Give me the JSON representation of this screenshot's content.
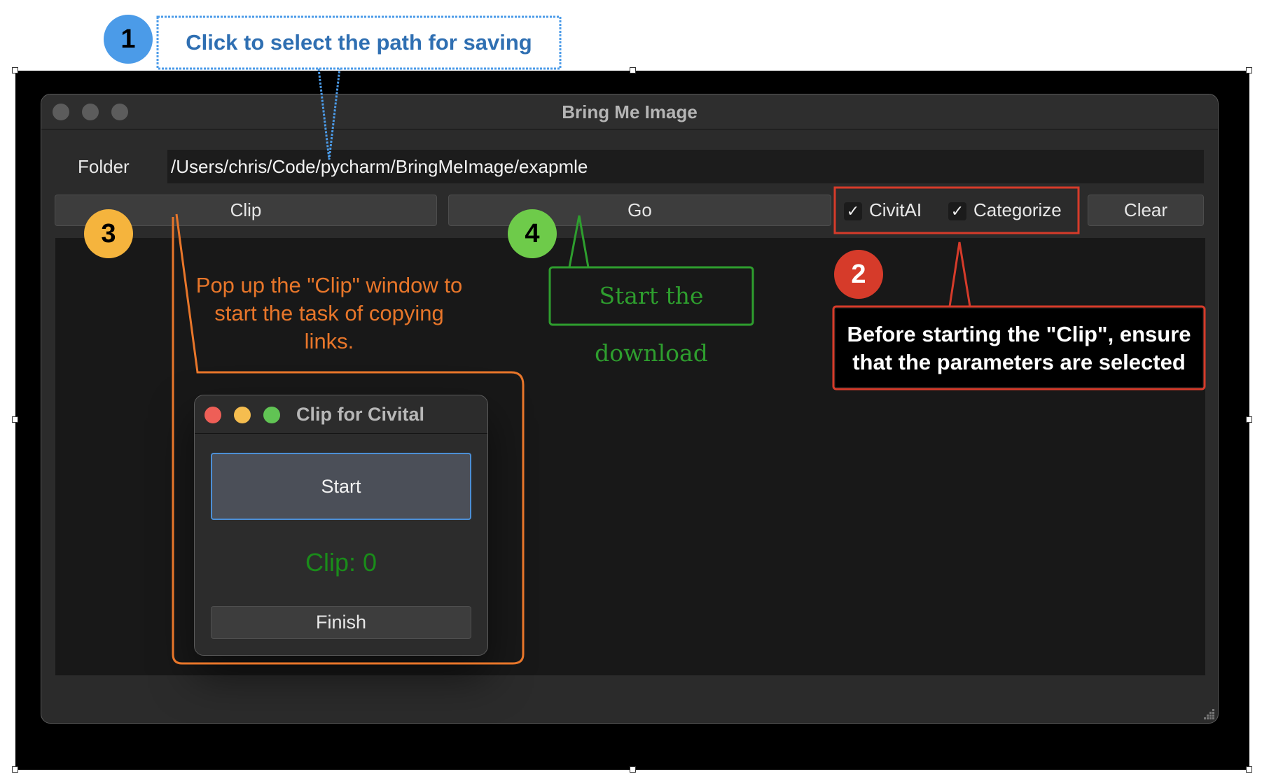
{
  "main_window": {
    "title": "Bring Me Image",
    "folder_label": "Folder",
    "folder_path": "/Users/chris/Code/pycharm/BringMeImage/exapmle",
    "clip_button": "Clip",
    "go_button": "Go",
    "checkbox_civitai": {
      "label": "CivitAI",
      "checked": true,
      "mark": "✓"
    },
    "checkbox_categorize": {
      "label": "Categorize",
      "checked": true,
      "mark": "✓"
    },
    "clear_button": "Clear"
  },
  "clip_window": {
    "title": "Clip for Civital",
    "start_button": "Start",
    "clip_count": "Clip: 0",
    "finish_button": "Finish"
  },
  "annotations": {
    "step1": {
      "number": "1",
      "text": "Click to select the path for saving",
      "color": "#2f6fb2",
      "badge_color": "#4b9be8"
    },
    "step2": {
      "number": "2",
      "text": "Before starting the \"Clip\", ensure that the parameters are selected",
      "color": "#d63b2a",
      "badge_color": "#d63b2a"
    },
    "step3": {
      "number": "3",
      "text": "Pop up the \"Clip\" window to start the task of copying links.",
      "color": "#e8762a",
      "badge_color": "#f5b43d"
    },
    "step4": {
      "number": "4",
      "text": "Start the download",
      "color": "#2e9e2e",
      "badge_color": "#6ecb4a"
    }
  }
}
